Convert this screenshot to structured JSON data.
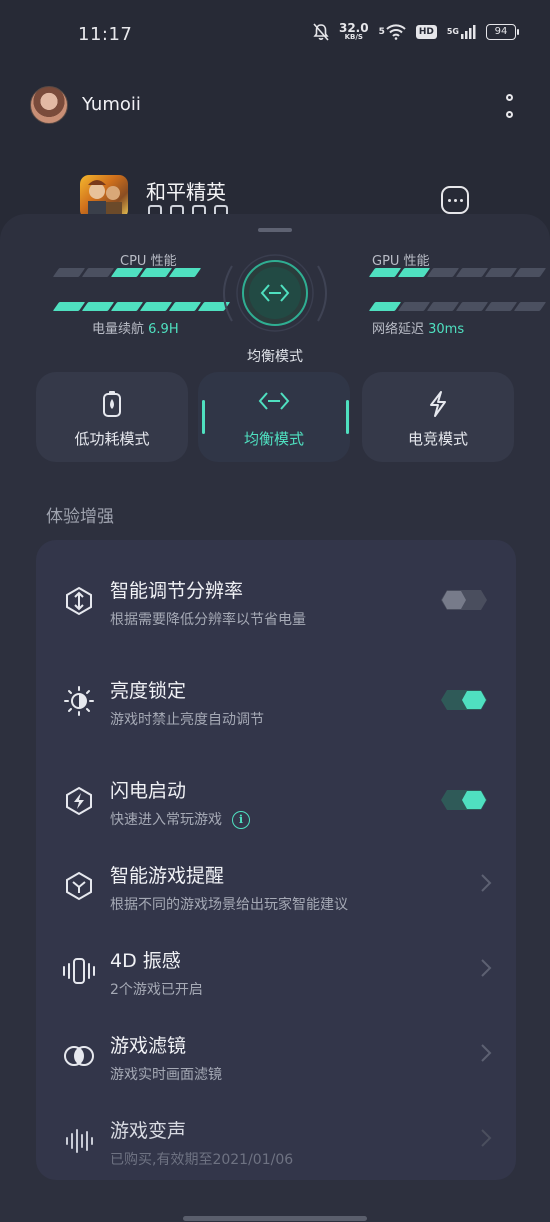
{
  "status_bar": {
    "time": "11:17",
    "net_speed_value": "32.0",
    "net_speed_unit": "KB/S",
    "wifi_label": "5",
    "hd_label": "HD",
    "signal_label": "5G",
    "battery": "94"
  },
  "profile": {
    "username": "Yumoii"
  },
  "game": {
    "name": "和平精英"
  },
  "performance": {
    "cpu_label": "CPU 性能",
    "cpu_level": 3,
    "cpu_total": 5,
    "gpu_label": "GPU 性能",
    "gpu_level": 2,
    "gpu_total": 6,
    "battery_prefix": "电量续航 ",
    "battery_value": "6.9H",
    "battery_level": 6,
    "battery_total": 6,
    "latency_prefix": "网络延迟 ",
    "latency_value": "30ms",
    "latency_level": 1,
    "latency_total": 6,
    "current_mode": "均衡模式",
    "accent": "#4fe0c0"
  },
  "modes": [
    {
      "label": "低功耗模式",
      "icon": "battery-drop-icon",
      "active": false
    },
    {
      "label": "均衡模式",
      "icon": "balance-arrows-icon",
      "active": true
    },
    {
      "label": "电竞模式",
      "icon": "lightning-icon",
      "active": false
    }
  ],
  "section": {
    "title": "体验增强"
  },
  "settings": [
    {
      "title": "智能调节分辨率",
      "subtitle": "根据需要降低分辨率以节省电量",
      "control": "toggle",
      "on": false,
      "icon": "resolution-icon"
    },
    {
      "title": "亮度锁定",
      "subtitle": "游戏时禁止亮度自动调节",
      "control": "toggle",
      "on": true,
      "icon": "brightness-icon"
    },
    {
      "title": "闪电启动",
      "subtitle": "快速进入常玩游戏",
      "control": "toggle",
      "on": true,
      "icon": "flash-launch-icon",
      "info_icon": "i"
    },
    {
      "title": "智能游戏提醒",
      "subtitle": "根据不同的游戏场景给出玩家智能建议",
      "control": "chevron",
      "icon": "smart-reminder-icon"
    },
    {
      "title": "4D 振感",
      "subtitle": "2个游戏已开启",
      "control": "chevron",
      "icon": "vibration-icon"
    },
    {
      "title": "游戏滤镜",
      "subtitle": "游戏实时画面滤镜",
      "control": "chevron",
      "icon": "filter-icon"
    },
    {
      "title": "游戏变声",
      "subtitle": "已购买,有效期至2021/01/06",
      "control": "chevron",
      "icon": "voice-changer-icon"
    }
  ]
}
